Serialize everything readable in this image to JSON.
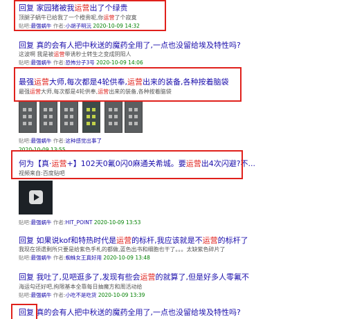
{
  "results": [
    {
      "title_parts": [
        "回复 家园猪被我",
        "运营",
        "出了个绿贵"
      ],
      "abstract_parts": [
        "顶腿子蜗牛已给我了一个橙贵呢,你",
        "运营",
        "了个寂寞"
      ],
      "forum": "最强蜗牛",
      "author": "小胡子明沅",
      "date": "2020-10-09 14:32"
    },
    {
      "title_parts": [
        "回复 真的会有人把中秋送的魔药全用了,一点也没留给埃及特性吗?",
        "",
        ""
      ],
      "abstract_parts": [
        "这波啊 我是被",
        "运营",
        "带诱秒士转生之变成阴阳人"
      ],
      "forum": "最强蜗牛",
      "author": "恐怖分子3号",
      "date": "2020-10-09 14:06"
    },
    {
      "title_parts": [
        "最强",
        "运营",
        "大师,每次都是4轮供奉,",
        "运营",
        "出来的装备,各种按着脑袋"
      ],
      "abstract_parts": [
        "最强",
        "运营",
        "大师,每次都是4轮供奉,",
        "运营",
        "出来的装备,各种按着脑袋"
      ],
      "forum": "最强蜗牛",
      "author": "这种感觉出事了",
      "date": "2020-10-09 13:55"
    },
    {
      "title_parts": [
        "何为【真·",
        "运营",
        "+】102天0氟0闪0麻通关希城。要",
        "运营",
        "出4次闪避?不..."
      ],
      "abstract_parts": [
        "视频来自:百度贴吧"
      ],
      "forum": "最强蜗牛",
      "author": "HIT_POINT",
      "date": "2020-10-09 13:53"
    },
    {
      "title_parts": [
        "回复 如果说kof和特热时代是",
        "运营",
        "的标杆,我应该就是不",
        "运营",
        "的标杆了"
      ],
      "abstract_parts": [
        "我现在领遗剩所只要是给紫色手札的都做,蓝色出书和细胞也干了。。。太缺紫色碎片了"
      ],
      "forum": "最强蜗牛",
      "author": "蜘蛛女王真好用",
      "date": "2020-10-09 13:48"
    },
    {
      "title_parts": [
        "回复 我吐了,见吧逛多了,发现有些会",
        "运营",
        "的就算了,但是好多人零氟不"
      ],
      "abstract_parts": [
        "海运勾还好吧,拘限基本全靠每日抽魔方和周活动给"
      ],
      "forum": "最强蜗牛",
      "author": "小吃不是吃货",
      "date": "2020-10-09 13:39"
    },
    {
      "title_parts": [
        "回复 真的会有人把中秋送的魔药全用了,一点也没留给埃及特性吗?"
      ]
    }
  ],
  "meta_labels": {
    "forum_prefix": "贴吧:",
    "author_prefix": "作者:"
  },
  "icons": {
    "video": "play-icon"
  },
  "colors": {
    "highlight": "#e0201b",
    "link": "#1a0dab",
    "date": "#008000",
    "box": "#e0201b"
  }
}
